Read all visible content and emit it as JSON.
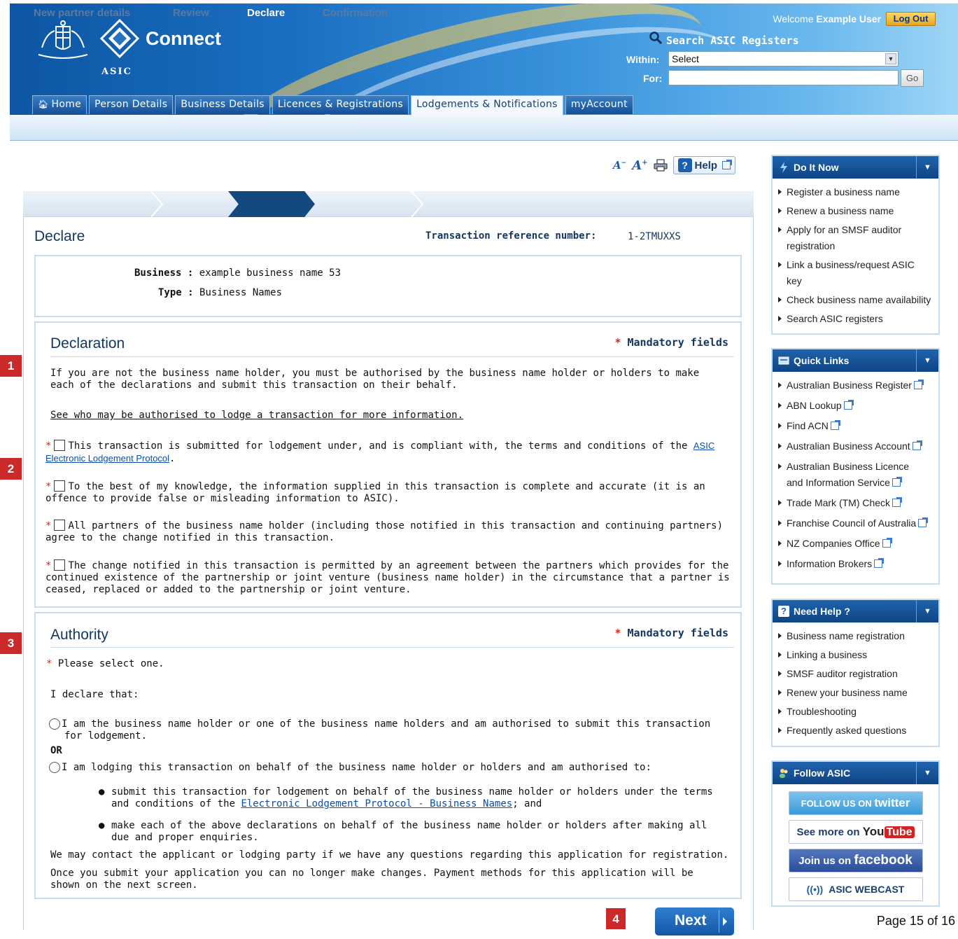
{
  "header": {
    "logo_text": "Connect",
    "logo_sub": "ASIC",
    "welcome_prefix": "Welcome",
    "user_name": "Example User",
    "logout_label": "Log Out",
    "search_title": "Search ASIC Registers",
    "within_label": "Within:",
    "within_value": "Select",
    "for_label": "For:",
    "for_value": "",
    "go_label": "Go"
  },
  "nav": {
    "tabs": [
      {
        "label": "Home"
      },
      {
        "label": "Person Details"
      },
      {
        "label": "Business Details"
      },
      {
        "label": "Licences & Registrations"
      },
      {
        "label": "Lodgements & Notifications",
        "active": true
      },
      {
        "label": "myAccount"
      }
    ]
  },
  "toolbar": {
    "help_label": "Help"
  },
  "steps": [
    "New partner details",
    "Review",
    "Declare",
    "Confirmation"
  ],
  "page": {
    "title": "Declare",
    "txn_label": "Transaction reference number:",
    "txn_value": "1-2TMUXXS"
  },
  "business": {
    "business_label": "Business :",
    "business_value": "example business name 53",
    "type_label": "Type :",
    "type_value": "Business Names"
  },
  "declaration": {
    "title": "Declaration",
    "mandatory": "Mandatory fields",
    "intro": "If you are not the business name holder, you must be authorised by the business name holder or holders to make each of the declarations and submit this transaction on their behalf.",
    "link": "See who may be authorised to lodge a transaction for more information.",
    "item1_text": "This transaction is submitted for lodgement under, and is compliant with, the terms and conditions of the",
    "item1_link": "ASIC Electronic Lodgement Protocol",
    "item2": "To the best of my knowledge, the information supplied in this transaction is complete and accurate (it is an offence to provide false or misleading information to ASIC).",
    "item3": "All partners of the business name holder (including those notified in this transaction and continuing partners) agree to the change notified in this transaction.",
    "item4": "The change notified in this transaction is permitted by an agreement between the partners which provides for the continued existence of the partnership or joint venture (business name holder) in the circumstance that a partner is ceased, replaced or added to the partnership or joint venture."
  },
  "authority": {
    "title": "Authority",
    "mandatory": "Mandatory fields",
    "select_one": "Please select one.",
    "i_declare": "I declare that:",
    "option1": "I am the business name holder or one of the business name holders and am authorised to submit this transaction for lodgement.",
    "or": "OR",
    "option2": "I am lodging this transaction on behalf of the business name holder or holders and am authorised to:",
    "bullet1_text": "submit this transaction for lodgement on behalf of the business name holder or holders under the terms and conditions of the",
    "bullet1_link": "Electronic Lodgement Protocol - Business Names",
    "bullet1_end": "; and",
    "bullet2": "make each of the above declarations on behalf of the business name holder or holders after making all due and proper enquiries.",
    "contact": "We may contact the applicant or lodging party if we have any questions regarding this application for registration.",
    "submit_note": "Once you submit your application you can no longer make changes. Payment methods for this application will be shown on the next screen."
  },
  "next_label": "Next",
  "markers": [
    "1",
    "2",
    "3",
    "4"
  ],
  "sidebar": {
    "do_it_now": {
      "title": "Do It Now",
      "items": [
        "Register a business name",
        "Renew a business name",
        "Apply for an SMSF auditor registration",
        "Link a business/request ASIC key",
        "Check business name availability",
        "Search ASIC registers"
      ]
    },
    "quick_links": {
      "title": "Quick Links",
      "items": [
        "Australian Business Register",
        "ABN Lookup",
        "Find ACN",
        "Australian Business Account",
        "Australian Business Licence and Information Service",
        "Trade Mark (TM) Check",
        "Franchise Council of Australia",
        "NZ Companies Office",
        "Information Brokers"
      ]
    },
    "need_help": {
      "title": "Need Help ?",
      "items": [
        "Business name registration",
        "Linking a business",
        "SMSF auditor registration",
        "Renew your business name",
        "Troubleshooting",
        "Frequently asked questions"
      ]
    },
    "follow": {
      "title": "Follow ASIC",
      "twitter_prefix": "FOLLOW US ON",
      "twitter_brand": "twitter",
      "youtube_prefix": "See more on",
      "youtube_you": "You",
      "youtube_tube": "Tube",
      "facebook_prefix": "Join us on",
      "facebook_brand": "facebook",
      "webcast": "ASIC WEBCAST"
    }
  },
  "footer": {
    "page": "Page 15 of 16"
  },
  "colors": {
    "brand_blue": "#14497f",
    "marker_red": "#cc2a2a",
    "mandatory_star": "#dd2211"
  }
}
